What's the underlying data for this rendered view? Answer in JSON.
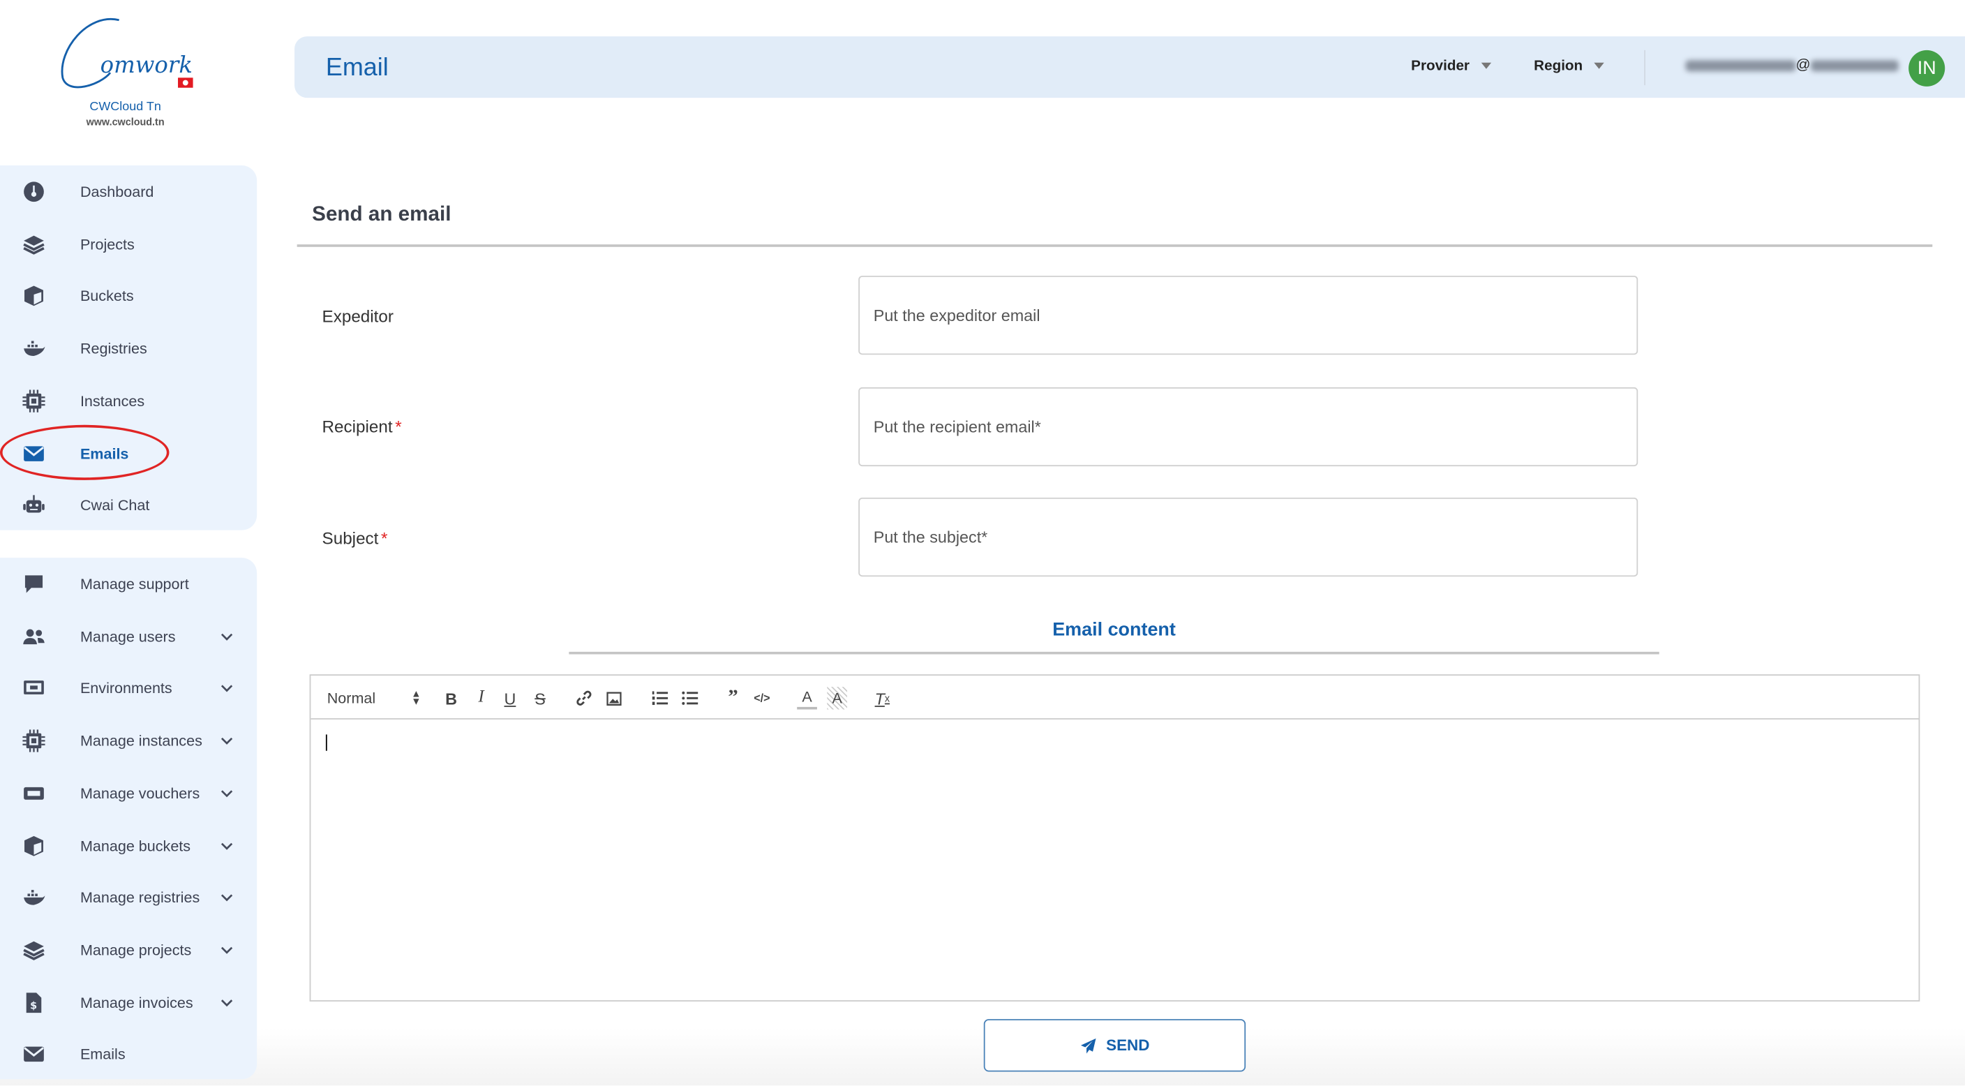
{
  "logo": {
    "wordmark": "Comwork",
    "brand": "CWCloud Tn",
    "site": "www.cwcloud.tn"
  },
  "header": {
    "title": "Email",
    "provider": "Provider",
    "region": "Region",
    "user_email_visible": "@",
    "avatar_initials": "IN"
  },
  "sidebar": {
    "main_items": [
      {
        "label": "Dashboard",
        "icon": "dashboard-icon"
      },
      {
        "label": "Projects",
        "icon": "layers-icon"
      },
      {
        "label": "Buckets",
        "icon": "cube-icon"
      },
      {
        "label": "Registries",
        "icon": "docker-icon"
      },
      {
        "label": "Instances",
        "icon": "chip-icon"
      },
      {
        "label": "Emails",
        "icon": "envelope-icon",
        "active": true
      },
      {
        "label": "Cwai Chat",
        "icon": "robot-icon"
      }
    ],
    "admin_items": [
      {
        "label": "Manage support",
        "icon": "chat-bubble-icon"
      },
      {
        "label": "Manage users",
        "icon": "users-icon",
        "expandable": true
      },
      {
        "label": "Environments",
        "icon": "monitor-icon",
        "expandable": true
      },
      {
        "label": "Manage instances",
        "icon": "chip-icon",
        "expandable": true
      },
      {
        "label": "Manage vouchers",
        "icon": "ticket-icon",
        "expandable": true
      },
      {
        "label": "Manage buckets",
        "icon": "cube-icon",
        "expandable": true
      },
      {
        "label": "Manage registries",
        "icon": "docker-icon",
        "expandable": true
      },
      {
        "label": "Manage projects",
        "icon": "layers-icon",
        "expandable": true
      },
      {
        "label": "Manage invoices",
        "icon": "invoice-icon",
        "expandable": true
      },
      {
        "label": "Emails",
        "icon": "envelope-icon"
      }
    ]
  },
  "form": {
    "heading": "Send an email",
    "fields": [
      {
        "label": "Expeditor",
        "required": false,
        "placeholder": "Put the expeditor email",
        "value": ""
      },
      {
        "label": "Recipient",
        "required": true,
        "placeholder": "Put the recipient email*",
        "value": ""
      },
      {
        "label": "Subject",
        "required": true,
        "placeholder": "Put the subject*",
        "value": ""
      }
    ],
    "required_mark": "*",
    "content_title": "Email content",
    "editor": {
      "format": "Normal",
      "content": ""
    },
    "send_label": "SEND"
  },
  "colors": {
    "accent": "#1560ab",
    "sidebar_bg": "#ebf3fd",
    "header_bg": "#e1ecf8",
    "avatar": "#43a047",
    "highlight_ring": "#e02424"
  }
}
